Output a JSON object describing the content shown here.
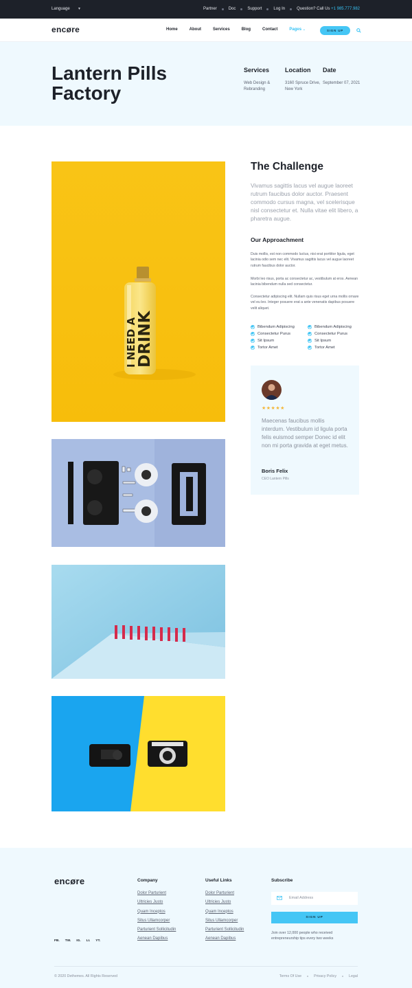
{
  "topbar": {
    "language": "Language",
    "links": [
      "Partner",
      "Doc",
      "Support",
      "Log In"
    ],
    "call_label": "Question? Call Us",
    "phone": "+1 985.777.982"
  },
  "nav": {
    "logo": "encøre",
    "menu": [
      "Home",
      "About",
      "Services",
      "Blog",
      "Contact",
      "Pages"
    ],
    "active_item": "Pages",
    "signup": "SIGN UP"
  },
  "hero": {
    "title_line1": "Lantern Pills",
    "title_line2": "Factory",
    "meta": {
      "services_label": "Services",
      "services_value": "Web Design & Rebranding",
      "location_label": "Location",
      "location_value": "3160 Spruce Drive, New York",
      "date_label": "Date",
      "date_value": "September 07, 2021"
    }
  },
  "gallery": {
    "bottle_text_1": "I NEED A",
    "bottle_text_2": "DRINK"
  },
  "content": {
    "challenge_title": "The Challenge",
    "challenge_lead": "Vivamus sagittis lacus vel augue laoreet rutrum faucibus dolor auctor. Praesent commodo cursus magna, vel scelerisque nisl consectetur et. Nulla vitae elit libero, a pharetra augue.",
    "approach_title": "Our Approachment",
    "paragraphs": [
      "Duis mollis, est non commodo luctus, nisi erat porttitor ligula, eget lacinia odio sem nec elit. Vivamus sagittis lacus vel augue laoreet rutrum faucibus dolor auctor.",
      "Morbi leo risus, porta ac consectetur ac, vestibulum at eros. Aenean lacinia bibendum nulla sed consectetur.",
      "Consectetur adipiscing elit. Nullam quis risus eget urna mollis ornare vel eu leo. Integer posuere erat a ante venenatis dapibus posuere velit aliquet."
    ],
    "checklist": [
      "Bibendum Adipiscing",
      "Bibendum Adipiscing",
      "Consectetur Purus",
      "Consectetur Purus",
      "Sit Ipsum",
      "Sit Ipsum",
      "Tortor Amet",
      "Tortor Amet"
    ]
  },
  "testimonial": {
    "stars": "★★★★★",
    "rating": 5,
    "quote": "Maecenas faucibus mollis interdum. Vestibulum id ligula porta felis euismod semper Donec id elit non mi porta gravida at eget metus.",
    "name": "Boris Felix",
    "role": "CEO Lantern Pills"
  },
  "footer": {
    "logo": "encøre",
    "socials": [
      "FB.",
      "TW.",
      "IG.",
      "LI.",
      "YT."
    ],
    "company_title": "Company",
    "company_links": [
      "Dolor Parturient",
      "Ultricies Justo",
      "Quam Inceptos",
      "Situs Ullamcorper",
      "Parturient Sollicitudin",
      "Aenean Dapibus"
    ],
    "useful_title": "Useful Links",
    "useful_links": [
      "Dolor Parturient",
      "Ultricies Justo",
      "Quam Inceptos",
      "Situs Ullamcorper",
      "Parturient Sollicitudin",
      "Aenean Dapibus"
    ],
    "subscribe_title": "Subscribe",
    "email_placeholder": "Email Address",
    "subscribe_button": "SIGN UP",
    "subscribe_note": "Join over 12,000 people who received entrepreneurship tips every two weeks",
    "copyright": "© 2020 Dethemes. All Rights Reserved",
    "legal_links": [
      "Terms Of Use",
      "Privacy Policy",
      "Legal"
    ]
  },
  "colors": {
    "accent": "#45c6f5",
    "dark": "#1d2129",
    "hero_bg": "#eff9fe",
    "star": "#f3b637"
  }
}
